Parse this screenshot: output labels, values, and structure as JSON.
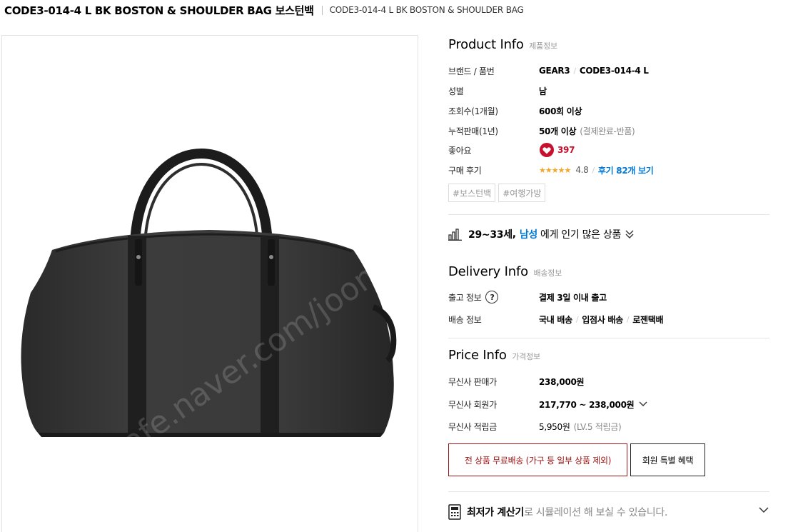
{
  "header": {
    "title": "CODE3-014-4 L BK BOSTON & SHOULDER BAG 보스턴백",
    "subtitle": "CODE3-014-4 L BK BOSTON & SHOULDER BAG"
  },
  "image": {
    "icon": "product-bag-image",
    "watermark": "cafe.naver.com/joonggonara"
  },
  "product_info": {
    "title": "Product Info",
    "title_kr": "제품정보",
    "brand_label": "브랜드 / 품번",
    "brand": "GEAR3",
    "code": "CODE3-014-4 L",
    "gender_label": "성별",
    "gender": "남",
    "views_label": "조회수(1개월)",
    "views": "600회 이상",
    "sales_label": "누적판매(1년)",
    "sales": "50개 이상",
    "sales_note": "(결제완료-반품)",
    "likes_label": "좋아요",
    "likes": "397",
    "review_label": "구매 후기",
    "stars": "★★★★★",
    "rating": "4.8",
    "review_link": "후기 82개 보기",
    "tags": [
      "#보스턴백",
      "#여행가방"
    ]
  },
  "popular": {
    "age": "29~33세",
    "comma": ",",
    "gender": "남성",
    "text": "에게 인기 많은 상품"
  },
  "delivery_info": {
    "title": "Delivery Info",
    "title_kr": "배송정보",
    "release_label": "출고 정보",
    "release": "결제 3일 이내 출고",
    "shipping_label": "배송 정보",
    "shipping": [
      "국내 배송",
      "입점사 배송",
      "로젠택배"
    ]
  },
  "price_info": {
    "title": "Price Info",
    "title_kr": "가격정보",
    "sale_label": "무신사 판매가",
    "sale_price": "238,000원",
    "member_label": "무신사 회원가",
    "member_price": "217,770 ~ 238,000원",
    "points_label": "무신사 적립금",
    "points": "5,950원",
    "points_note": "(LV.5 적립금)"
  },
  "buttons": {
    "free_shipping": "전 상품 무료배송 (가구 등 일부 상품 제외)",
    "member_benefit": "회원 특별 혜택"
  },
  "calculator": {
    "bold": "최저가 계산기",
    "text": "로 시뮬레이션 해 보실 수 있습니다."
  },
  "colors": {
    "like_red": "#c8102e",
    "link_blue": "#0078d7",
    "free_btn": "#a01515",
    "star": "#f5a623"
  }
}
